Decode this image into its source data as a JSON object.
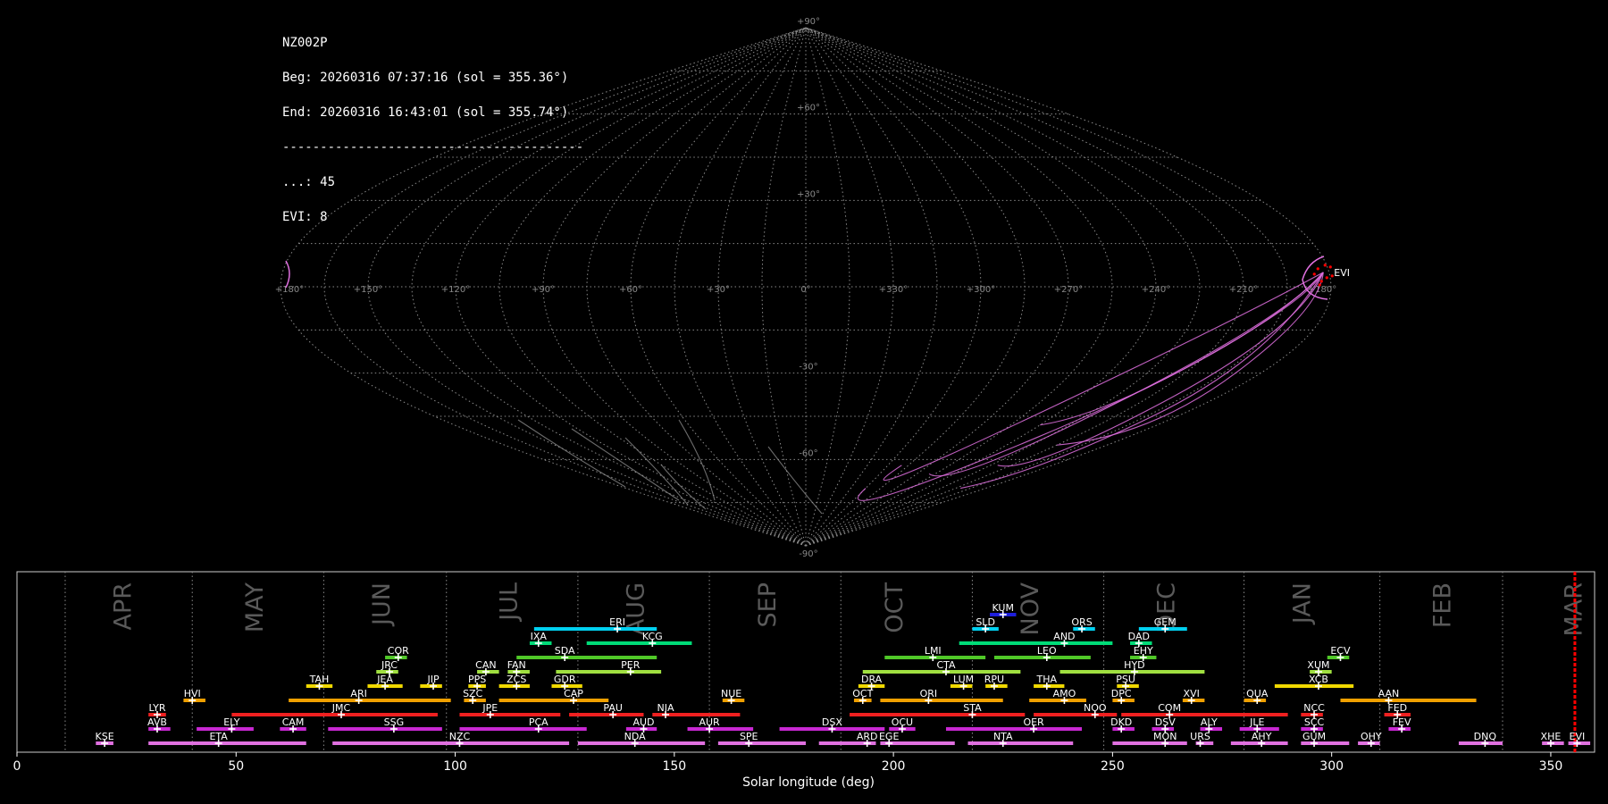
{
  "header": {
    "station": "NZ002P",
    "begin": "Beg: 20260316 07:37:16 (sol = 355.36°)",
    "end": "End: 20260316 16:43:01 (sol = 355.74°)",
    "separator": "----------------------------------------",
    "count_sporadic": "...: 45",
    "count_evi": "EVI: 8"
  },
  "colors": {
    "sky_track": "#e070e0",
    "sky_track_gray": "#999999",
    "current_marker": "#ff0000"
  },
  "chart_data": [
    {
      "type": "scatter",
      "projection": "sinusoidal",
      "lat_labels": [
        "+90°",
        "+60°",
        "+30°",
        "0°",
        "-30°",
        "-60°",
        "-90°"
      ],
      "lon_labels": [
        "+180°",
        "+150°",
        "+120°",
        "+90°",
        "+60°",
        "+30°",
        "0°",
        "+330°",
        "+300°",
        "+270°",
        "+240°",
        "+210°",
        "+180°"
      ],
      "radiant_label": "EVI",
      "radiant": {
        "lon": 178,
        "lat": 5
      },
      "grid": true
    },
    {
      "type": "bar",
      "title": "",
      "xlabel": "Solar longitude (deg)",
      "xlim": [
        0,
        360
      ],
      "xticks": [
        "0",
        "50",
        "100",
        "150",
        "200",
        "250",
        "300",
        "350"
      ],
      "month_labels": [
        {
          "label": "APR",
          "x": 24
        },
        {
          "label": "MAY",
          "x": 54
        },
        {
          "label": "JUN",
          "x": 83
        },
        {
          "label": "JUL",
          "x": 112
        },
        {
          "label": "AUG",
          "x": 141
        },
        {
          "label": "SEP",
          "x": 171
        },
        {
          "label": "OCT",
          "x": 200
        },
        {
          "label": "NOV",
          "x": 231
        },
        {
          "label": "DEC",
          "x": 262
        },
        {
          "label": "JAN",
          "x": 293
        },
        {
          "label": "FEB",
          "x": 325
        },
        {
          "label": "MAR",
          "x": 355
        }
      ],
      "month_boundaries": [
        11,
        40,
        70,
        98,
        128,
        158,
        188,
        218,
        248,
        280,
        311,
        339
      ],
      "current_sol": 355.5,
      "showers": [
        {
          "code": "KUM",
          "start": 222,
          "end": 228,
          "peak": 225,
          "row": 11,
          "color": "#1e1edc"
        },
        {
          "code": "ERI",
          "start": 118,
          "end": 146,
          "peak": 137,
          "row": 10,
          "color": "#00d0f0"
        },
        {
          "code": "SLD",
          "start": 218,
          "end": 224,
          "peak": 221,
          "row": 10,
          "color": "#00d0f0"
        },
        {
          "code": "ORS",
          "start": 241,
          "end": 246,
          "peak": 243,
          "row": 10,
          "color": "#00d0f0"
        },
        {
          "code": "GEM",
          "start": 256,
          "end": 267,
          "peak": 262,
          "row": 10,
          "color": "#00d0f0"
        },
        {
          "code": "IXA",
          "start": 117,
          "end": 122,
          "peak": 119,
          "row": 9,
          "color": "#00dc78"
        },
        {
          "code": "KCG",
          "start": 130,
          "end": 154,
          "peak": 145,
          "row": 9,
          "color": "#00dc78"
        },
        {
          "code": "AND",
          "start": 215,
          "end": 250,
          "peak": 239,
          "row": 9,
          "color": "#00dc78"
        },
        {
          "code": "DAD",
          "start": 254,
          "end": 259,
          "peak": 256,
          "row": 9,
          "color": "#00dc78"
        },
        {
          "code": "COR",
          "start": 84,
          "end": 89,
          "peak": 87,
          "row": 8,
          "color": "#50c828"
        },
        {
          "code": "SDA",
          "start": 114,
          "end": 146,
          "peak": 125,
          "row": 8,
          "color": "#50c828"
        },
        {
          "code": "LMI",
          "start": 198,
          "end": 221,
          "peak": 209,
          "row": 8,
          "color": "#50c828"
        },
        {
          "code": "LEO",
          "start": 223,
          "end": 245,
          "peak": 235,
          "row": 8,
          "color": "#50c828"
        },
        {
          "code": "EHY",
          "start": 254,
          "end": 260,
          "peak": 257,
          "row": 8,
          "color": "#50c828"
        },
        {
          "code": "ECV",
          "start": 299,
          "end": 304,
          "peak": 302,
          "row": 8,
          "color": "#50c828"
        },
        {
          "code": "JRC",
          "start": 82,
          "end": 87,
          "peak": 85,
          "row": 7,
          "color": "#a0e040"
        },
        {
          "code": "CAN",
          "start": 105,
          "end": 110,
          "peak": 107,
          "row": 7,
          "color": "#a0e040"
        },
        {
          "code": "FAN",
          "start": 112,
          "end": 117,
          "peak": 114,
          "row": 7,
          "color": "#a0e040"
        },
        {
          "code": "PER",
          "start": 123,
          "end": 147,
          "peak": 140,
          "row": 7,
          "color": "#a0e040"
        },
        {
          "code": "CTA",
          "start": 193,
          "end": 229,
          "peak": 212,
          "row": 7,
          "color": "#a0e040"
        },
        {
          "code": "HYD",
          "start": 238,
          "end": 271,
          "peak": 255,
          "row": 7,
          "color": "#a0e040"
        },
        {
          "code": "XUM",
          "start": 295,
          "end": 300,
          "peak": 297,
          "row": 7,
          "color": "#a0e040"
        },
        {
          "code": "TAH",
          "start": 66,
          "end": 72,
          "peak": 69,
          "row": 6,
          "color": "#f0d800"
        },
        {
          "code": "JEA",
          "start": 80,
          "end": 88,
          "peak": 84,
          "row": 6,
          "color": "#f0d800"
        },
        {
          "code": "JIP",
          "start": 92,
          "end": 97,
          "peak": 95,
          "row": 6,
          "color": "#f0d800"
        },
        {
          "code": "PPS",
          "start": 103,
          "end": 107,
          "peak": 105,
          "row": 6,
          "color": "#f0d800"
        },
        {
          "code": "ZCS",
          "start": 110,
          "end": 117,
          "peak": 114,
          "row": 6,
          "color": "#f0d800"
        },
        {
          "code": "GDR",
          "start": 122,
          "end": 129,
          "peak": 125,
          "row": 6,
          "color": "#f0d800"
        },
        {
          "code": "DRA",
          "start": 192,
          "end": 198,
          "peak": 195,
          "row": 6,
          "color": "#f0d800"
        },
        {
          "code": "LUM",
          "start": 213,
          "end": 218,
          "peak": 216,
          "row": 6,
          "color": "#f0d800"
        },
        {
          "code": "RPU",
          "start": 221,
          "end": 226,
          "peak": 223,
          "row": 6,
          "color": "#f0d800"
        },
        {
          "code": "THA",
          "start": 232,
          "end": 239,
          "peak": 235,
          "row": 6,
          "color": "#f0d800"
        },
        {
          "code": "PSU",
          "start": 251,
          "end": 256,
          "peak": 253,
          "row": 6,
          "color": "#f0d800"
        },
        {
          "code": "XCB",
          "start": 287,
          "end": 305,
          "peak": 297,
          "row": 6,
          "color": "#f0d800"
        },
        {
          "code": "HVI",
          "start": 38,
          "end": 43,
          "peak": 40,
          "row": 5,
          "color": "#f0a000"
        },
        {
          "code": "ARI",
          "start": 62,
          "end": 99,
          "peak": 78,
          "row": 5,
          "color": "#f0a000"
        },
        {
          "code": "SZC",
          "start": 102,
          "end": 107,
          "peak": 104,
          "row": 5,
          "color": "#f0a000"
        },
        {
          "code": "CAP",
          "start": 110,
          "end": 135,
          "peak": 127,
          "row": 5,
          "color": "#f0a000"
        },
        {
          "code": "NUE",
          "start": 161,
          "end": 166,
          "peak": 163,
          "row": 5,
          "color": "#f0a000"
        },
        {
          "code": "OCT",
          "start": 191,
          "end": 195,
          "peak": 193,
          "row": 5,
          "color": "#f0a000"
        },
        {
          "code": "ORI",
          "start": 197,
          "end": 225,
          "peak": 208,
          "row": 5,
          "color": "#f0a000"
        },
        {
          "code": "AMO",
          "start": 231,
          "end": 244,
          "peak": 239,
          "row": 5,
          "color": "#f0a000"
        },
        {
          "code": "DPC",
          "start": 250,
          "end": 255,
          "peak": 252,
          "row": 5,
          "color": "#f0a000"
        },
        {
          "code": "XVI",
          "start": 266,
          "end": 271,
          "peak": 268,
          "row": 5,
          "color": "#f0a000"
        },
        {
          "code": "QUA",
          "start": 280,
          "end": 285,
          "peak": 283,
          "row": 5,
          "color": "#f0a000"
        },
        {
          "code": "AAN",
          "start": 302,
          "end": 333,
          "peak": 313,
          "row": 5,
          "color": "#f0a000"
        },
        {
          "code": "LYR",
          "start": 30,
          "end": 34,
          "peak": 32,
          "row": 4,
          "color": "#f02020"
        },
        {
          "code": "JMC",
          "start": 49,
          "end": 96,
          "peak": 74,
          "row": 4,
          "color": "#f02020"
        },
        {
          "code": "JPE",
          "start": 101,
          "end": 124,
          "peak": 108,
          "row": 4,
          "color": "#f02020"
        },
        {
          "code": "PAU",
          "start": 126,
          "end": 143,
          "peak": 136,
          "row": 4,
          "color": "#f02020"
        },
        {
          "code": "NIA",
          "start": 145,
          "end": 165,
          "peak": 148,
          "row": 4,
          "color": "#f02020"
        },
        {
          "code": "STA",
          "start": 190,
          "end": 230,
          "peak": 218,
          "row": 4,
          "color": "#f02020"
        },
        {
          "code": "NOO",
          "start": 232,
          "end": 251,
          "peak": 246,
          "row": 4,
          "color": "#f02020"
        },
        {
          "code": "COM",
          "start": 252,
          "end": 290,
          "peak": 263,
          "row": 4,
          "color": "#f02020"
        },
        {
          "code": "NCC",
          "start": 293,
          "end": 298,
          "peak": 296,
          "row": 4,
          "color": "#f02020"
        },
        {
          "code": "FED",
          "start": 312,
          "end": 318,
          "peak": 315,
          "row": 4,
          "color": "#f02020"
        },
        {
          "code": "AVB",
          "start": 30,
          "end": 35,
          "peak": 32,
          "row": 3,
          "color": "#c828d2"
        },
        {
          "code": "ELY",
          "start": 41,
          "end": 54,
          "peak": 49,
          "row": 3,
          "color": "#c828d2"
        },
        {
          "code": "CAM",
          "start": 60,
          "end": 66,
          "peak": 63,
          "row": 3,
          "color": "#c828d2"
        },
        {
          "code": "SSG",
          "start": 71,
          "end": 97,
          "peak": 86,
          "row": 3,
          "color": "#c828d2"
        },
        {
          "code": "PCA",
          "start": 101,
          "end": 130,
          "peak": 119,
          "row": 3,
          "color": "#c828d2"
        },
        {
          "code": "AUD",
          "start": 139,
          "end": 146,
          "peak": 143,
          "row": 3,
          "color": "#c828d2"
        },
        {
          "code": "AUR",
          "start": 153,
          "end": 168,
          "peak": 158,
          "row": 3,
          "color": "#c828d2"
        },
        {
          "code": "DSX",
          "start": 174,
          "end": 198,
          "peak": 186,
          "row": 3,
          "color": "#c828d2"
        },
        {
          "code": "OCU",
          "start": 199,
          "end": 205,
          "peak": 202,
          "row": 3,
          "color": "#c828d2"
        },
        {
          "code": "OER",
          "start": 212,
          "end": 243,
          "peak": 232,
          "row": 3,
          "color": "#c828d2"
        },
        {
          "code": "DKD",
          "start": 250,
          "end": 255,
          "peak": 252,
          "row": 3,
          "color": "#c828d2"
        },
        {
          "code": "DSV",
          "start": 259,
          "end": 264,
          "peak": 262,
          "row": 3,
          "color": "#c828d2"
        },
        {
          "code": "ALY",
          "start": 270,
          "end": 275,
          "peak": 272,
          "row": 3,
          "color": "#c828d2"
        },
        {
          "code": "JLE",
          "start": 279,
          "end": 288,
          "peak": 283,
          "row": 3,
          "color": "#c828d2"
        },
        {
          "code": "SCC",
          "start": 293,
          "end": 298,
          "peak": 296,
          "row": 3,
          "color": "#c828d2"
        },
        {
          "code": "FEV",
          "start": 313,
          "end": 318,
          "peak": 316,
          "row": 3,
          "color": "#c828d2"
        },
        {
          "code": "KSE",
          "start": 18,
          "end": 22,
          "peak": 20,
          "row": 2,
          "color": "#e070e0"
        },
        {
          "code": "ETA",
          "start": 30,
          "end": 66,
          "peak": 46,
          "row": 2,
          "color": "#e070e0"
        },
        {
          "code": "NZC",
          "start": 72,
          "end": 126,
          "peak": 101,
          "row": 2,
          "color": "#e070e0"
        },
        {
          "code": "NDA",
          "start": 128,
          "end": 157,
          "peak": 141,
          "row": 2,
          "color": "#e070e0"
        },
        {
          "code": "SPE",
          "start": 160,
          "end": 180,
          "peak": 167,
          "row": 2,
          "color": "#e070e0"
        },
        {
          "code": "ARD",
          "start": 183,
          "end": 196,
          "peak": 194,
          "row": 2,
          "color": "#e070e0"
        },
        {
          "code": "EGE",
          "start": 197,
          "end": 214,
          "peak": 199,
          "row": 2,
          "color": "#e070e0"
        },
        {
          "code": "NTA",
          "start": 217,
          "end": 241,
          "peak": 225,
          "row": 2,
          "color": "#e070e0"
        },
        {
          "code": "MON",
          "start": 250,
          "end": 267,
          "peak": 262,
          "row": 2,
          "color": "#e070e0"
        },
        {
          "code": "URS",
          "start": 269,
          "end": 273,
          "peak": 270,
          "row": 2,
          "color": "#e070e0"
        },
        {
          "code": "AHY",
          "start": 277,
          "end": 290,
          "peak": 284,
          "row": 2,
          "color": "#e070e0"
        },
        {
          "code": "GUM",
          "start": 293,
          "end": 304,
          "peak": 296,
          "row": 2,
          "color": "#e070e0"
        },
        {
          "code": "OHY",
          "start": 306,
          "end": 311,
          "peak": 309,
          "row": 2,
          "color": "#e070e0"
        },
        {
          "code": "DNQ",
          "start": 329,
          "end": 339,
          "peak": 335,
          "row": 2,
          "color": "#e070e0"
        },
        {
          "code": "XHE",
          "start": 348,
          "end": 353,
          "peak": 350,
          "row": 2,
          "color": "#e070e0"
        },
        {
          "code": "EVI",
          "start": 354,
          "end": 359,
          "peak": 356,
          "row": 2,
          "color": "#e070e0"
        }
      ]
    }
  ]
}
